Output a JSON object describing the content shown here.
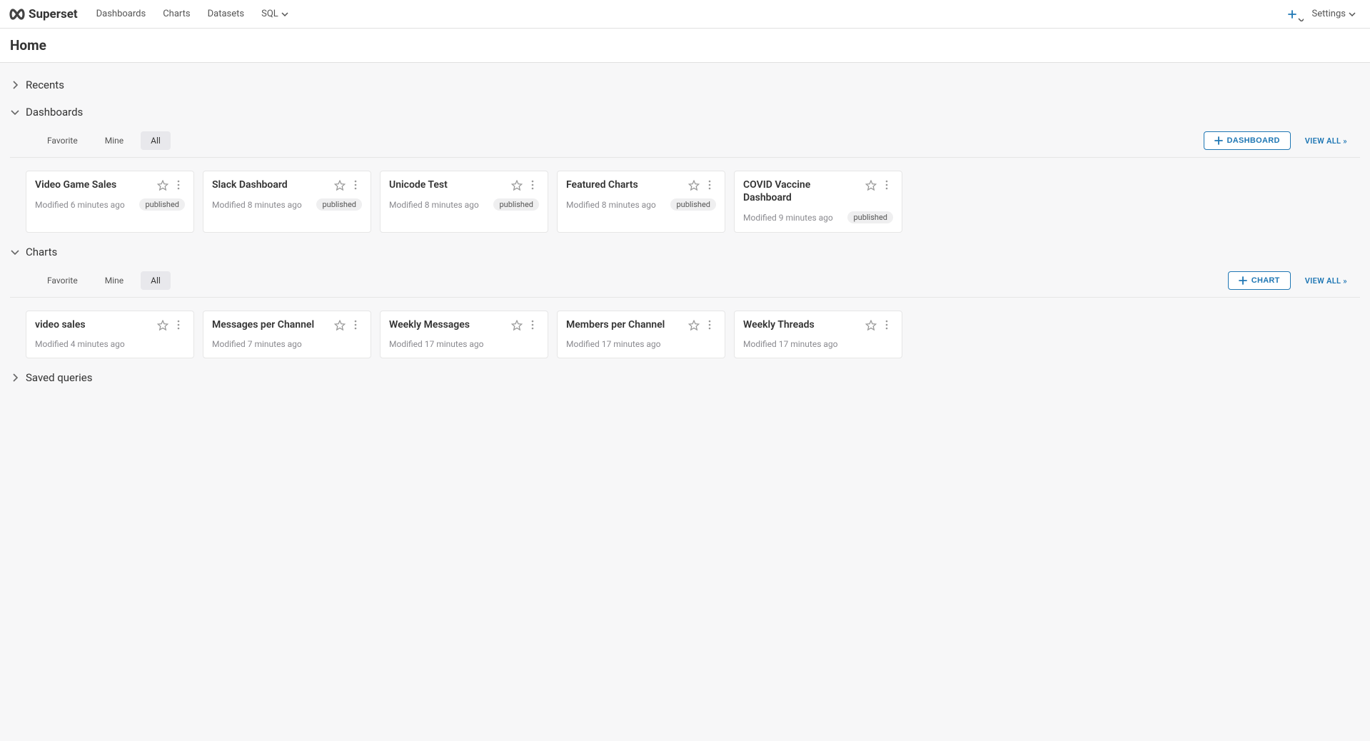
{
  "brand": "Superset",
  "nav": {
    "dashboards": "Dashboards",
    "charts": "Charts",
    "datasets": "Datasets",
    "sql": "SQL"
  },
  "settings_label": "Settings",
  "page_title": "Home",
  "sections": {
    "recents": {
      "title": "Recents",
      "expanded": false
    },
    "dashboards": {
      "title": "Dashboards",
      "expanded": true,
      "tabs": {
        "favorite": "Favorite",
        "mine": "Mine",
        "all": "All"
      },
      "active_tab": "all",
      "create_button": "DASHBOARD",
      "view_all": "VIEW ALL »",
      "cards": [
        {
          "title": "Video Game Sales",
          "modified": "Modified 6 minutes ago",
          "status": "published"
        },
        {
          "title": "Slack Dashboard",
          "modified": "Modified 8 minutes ago",
          "status": "published"
        },
        {
          "title": "Unicode Test",
          "modified": "Modified 8 minutes ago",
          "status": "published"
        },
        {
          "title": "Featured Charts",
          "modified": "Modified 8 minutes ago",
          "status": "published"
        },
        {
          "title": "COVID Vaccine Dashboard",
          "modified": "Modified 9 minutes ago",
          "status": "published"
        }
      ]
    },
    "charts": {
      "title": "Charts",
      "expanded": true,
      "tabs": {
        "favorite": "Favorite",
        "mine": "Mine",
        "all": "All"
      },
      "active_tab": "all",
      "create_button": "CHART",
      "view_all": "VIEW ALL »",
      "cards": [
        {
          "title": "video sales",
          "modified": "Modified 4 minutes ago"
        },
        {
          "title": "Messages per Channel",
          "modified": "Modified 7 minutes ago"
        },
        {
          "title": "Weekly Messages",
          "modified": "Modified 17 minutes ago"
        },
        {
          "title": "Members per Channel",
          "modified": "Modified 17 minutes ago"
        },
        {
          "title": "Weekly Threads",
          "modified": "Modified 17 minutes ago"
        }
      ]
    },
    "saved_queries": {
      "title": "Saved queries",
      "expanded": false
    }
  }
}
